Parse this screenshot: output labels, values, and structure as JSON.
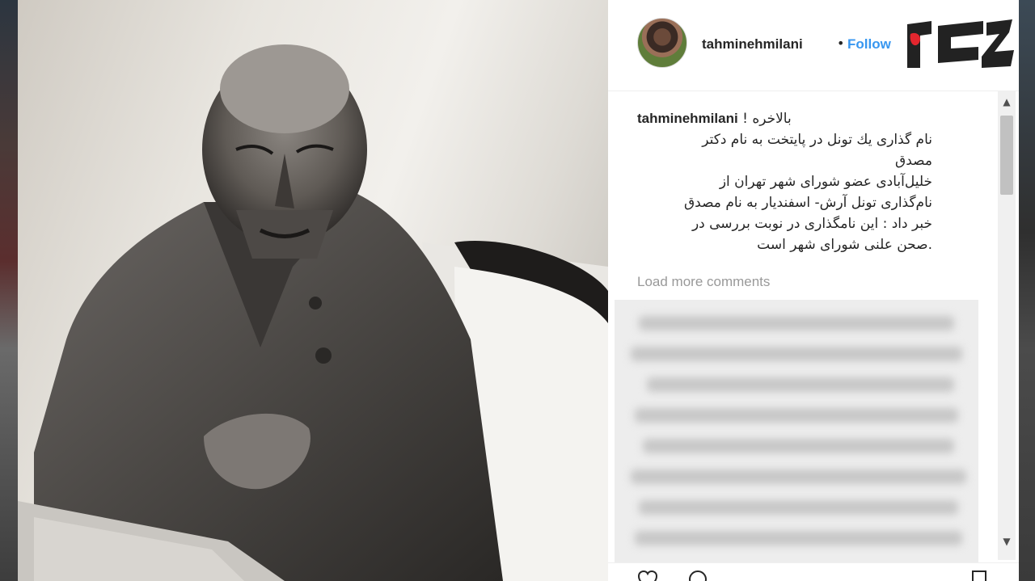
{
  "post": {
    "username": "tahminehmilani",
    "separator": "•",
    "follow_label": "Follow"
  },
  "caption": {
    "username": "tahminehmilani",
    "lines": [
      "! بالاخره",
      "نام گذاری یك تونل در پایتخت به نام دکتر",
      "مصدق",
      "خلیل‌آبادی عضو شورای شهر تهران از",
      "نام‌گذاری تونل آرش- اسفندیار به نام مصدق",
      "خبر داد : این نامگذاری در نوبت بررسی در",
      ".صحن علنی شورای شهر است"
    ]
  },
  "load_more_label": "Load more comments",
  "scrollbar": {
    "up_glyph": "▲",
    "down_glyph": "▼"
  },
  "icons": [
    "heart-icon",
    "comment-icon",
    "bookmark-icon"
  ],
  "colors": {
    "accent": "#3897f0",
    "muted": "#999999",
    "text": "#262626",
    "logo_red": "#e3262e"
  }
}
